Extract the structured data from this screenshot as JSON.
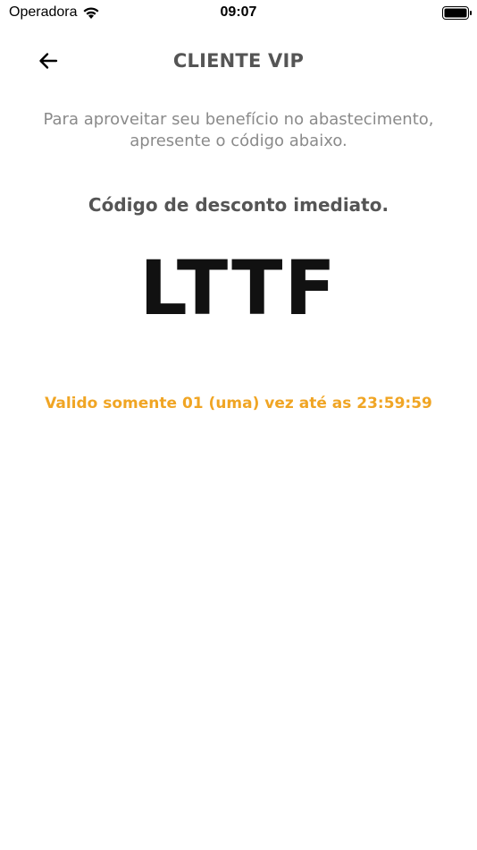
{
  "status_bar": {
    "carrier": "Operadora",
    "time": "09:07",
    "wifi_icon": "wifi-icon",
    "battery_icon": "battery-icon"
  },
  "header": {
    "back_icon": "arrow-left-icon",
    "title": "CLIENTE VIP"
  },
  "content": {
    "intro_line1": "Para aproveitar seu benefício no abastecimento,",
    "intro_line2": "apresente o código abaixo.",
    "subtitle": "Código de desconto imediato.",
    "code": "LTTF",
    "validity": "Valido somente 01 (uma) vez até as 23:59:59"
  },
  "colors": {
    "accent": "#f0a524",
    "title": "#555555",
    "muted_text": "#8a8a8a",
    "code_text": "#111111",
    "background": "#ffffff"
  }
}
